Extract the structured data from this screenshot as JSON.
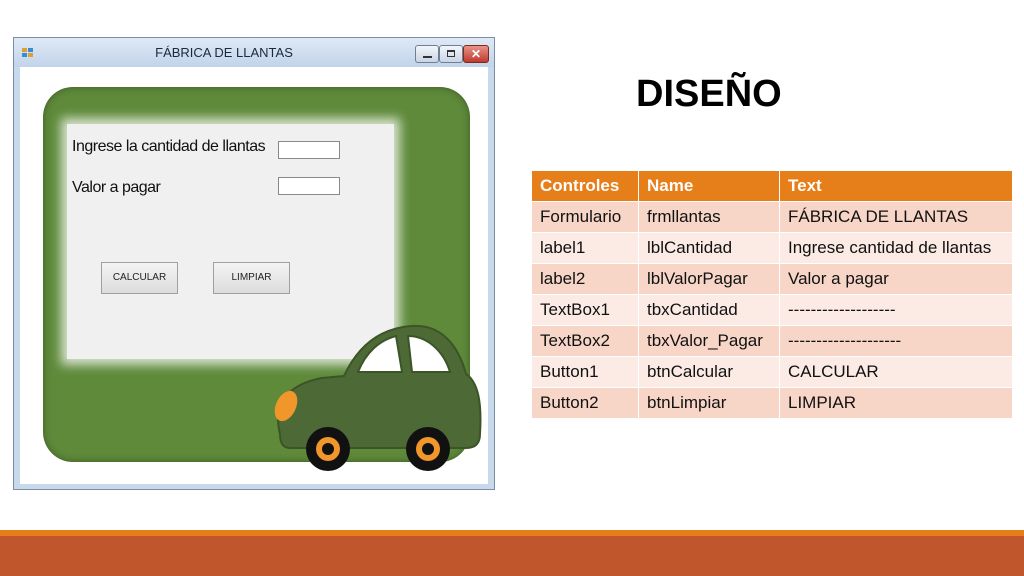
{
  "window": {
    "title": "FÁBRICA DE LLANTAS",
    "close_glyph": "✕"
  },
  "form": {
    "label_cantidad": "Ingrese la cantidad de llantas",
    "label_valor": "Valor a pagar",
    "input_cantidad_value": "",
    "input_valor_value": "",
    "button_calcular": "CALCULAR",
    "button_limpiar": "LIMPIAR"
  },
  "slide": {
    "heading": "DISEÑO"
  },
  "table": {
    "headers": [
      "Controles",
      "Name",
      "Text"
    ],
    "rows": [
      [
        "Formulario",
        "frmllantas",
        "FÁBRICA DE LLANTAS"
      ],
      [
        "label1",
        "lblCantidad",
        "Ingrese cantidad de llantas"
      ],
      [
        "label2",
        "lblValorPagar",
        "Valor a pagar"
      ],
      [
        "TextBox1",
        "tbxCantidad",
        "-------------------"
      ],
      [
        "TextBox2",
        "tbxValor_Pagar",
        "--------------------"
      ],
      [
        "Button1",
        "btnCalcular",
        "CALCULAR"
      ],
      [
        "Button2",
        "btnLimpiar",
        "LIMPIAR"
      ]
    ]
  },
  "colors": {
    "header_orange": "#e67e1a",
    "row_dark": "#f7d6c8",
    "row_light": "#fbebe4",
    "frame_green": "#5e8a3a",
    "band_rust": "#c0562c"
  }
}
